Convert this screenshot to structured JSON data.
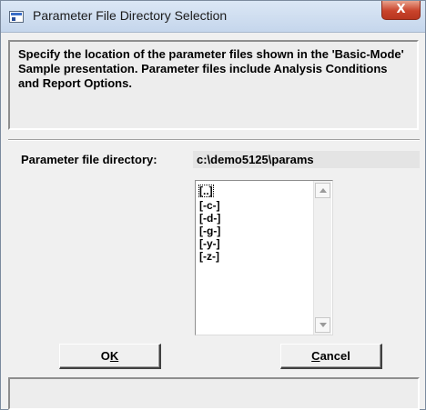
{
  "window": {
    "title": "Parameter File Directory Selection",
    "close_label": "X"
  },
  "description": {
    "text": "Specify the location of the parameter files shown in the 'Basic-Mode' Sample presentation.  Parameter files include Analysis Conditions and Report Options."
  },
  "directory": {
    "label": "Parameter file directory:",
    "value": "c:\\demo5125\\params"
  },
  "listbox": {
    "items": [
      "[..]",
      "[-c-]",
      "[-d-]",
      "[-g-]",
      "[-y-]",
      "[-z-]"
    ],
    "focused_index": 0
  },
  "buttons": {
    "ok": {
      "prefix": "O",
      "mnemonic": "K",
      "suffix": ""
    },
    "cancel": {
      "prefix": "",
      "mnemonic": "C",
      "suffix": "ancel"
    }
  },
  "status": {
    "text": ""
  },
  "colors": {
    "dialog_background": "#f0f0f0",
    "close_button": "#c9432b",
    "title_bar": "#c5d6ec"
  },
  "icons": [
    "app-window-icon",
    "close-icon",
    "scroll-up-arrow-icon",
    "scroll-down-arrow-icon"
  ]
}
